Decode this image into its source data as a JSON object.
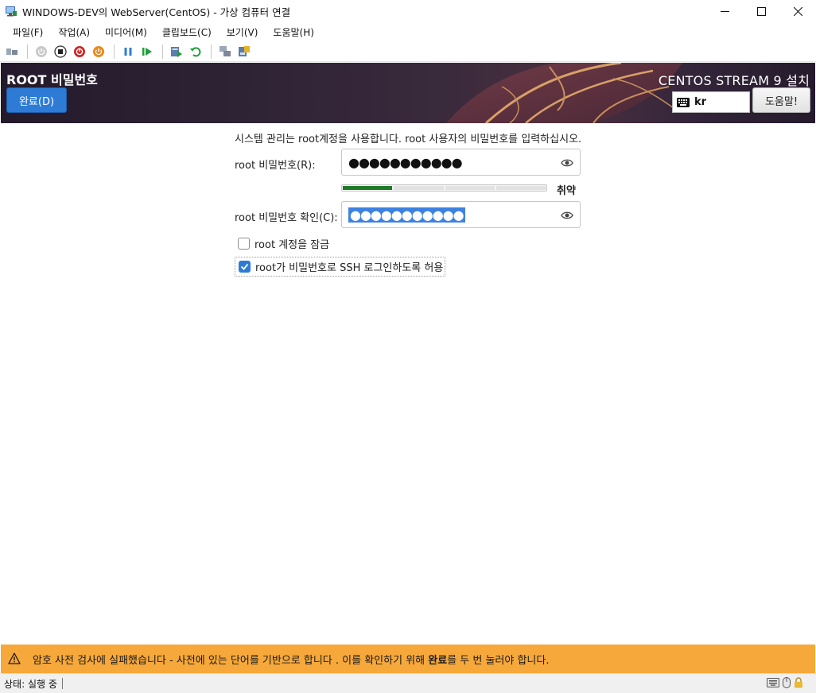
{
  "window": {
    "title": "WINDOWS-DEV의 WebServer(CentOS) - 가상 컴퓨터 연결",
    "minimize_glyph": "—",
    "maximize_glyph": "☐",
    "close_glyph": "✕"
  },
  "menubar": {
    "items": [
      {
        "label": "파일(F)"
      },
      {
        "label": "작업(A)"
      },
      {
        "label": "미디어(M)"
      },
      {
        "label": "클립보드(C)"
      },
      {
        "label": "보기(V)"
      },
      {
        "label": "도움말(H)"
      }
    ]
  },
  "toolbar": {
    "icons": [
      "ctrl-alt-del-icon",
      "start-icon",
      "turn-off-icon",
      "shutdown-icon",
      "save-icon",
      "pause-icon",
      "resume-icon",
      "checkpoint-icon",
      "revert-icon",
      "enhanced-session-icon",
      "share-icon"
    ]
  },
  "header": {
    "spoke_title": "ROOT 비밀번호",
    "done_label": "완료(D)",
    "product_title": "CENTOS STREAM 9 설치",
    "keyboard_layout": "kr",
    "help_label": "도움말!"
  },
  "form": {
    "description": "시스템 관리는 root계정을 사용합니다. root 사용자의 비밀번호를 입력하십시오.",
    "password_label": "root 비밀번호(R):",
    "password_value": "●●●●●●●●●●●",
    "strength_fraction": 0.25,
    "strength_label": "취약",
    "confirm_label": "root 비밀번호 확인(C):",
    "confirm_value": "●●●●●●●●●●●",
    "lock_label": "root 계정을 잠금",
    "lock_checked": false,
    "ssh_label": "root가 비밀번호로 SSH 로그인하도록 허용",
    "ssh_checked": true
  },
  "warning": {
    "text_before": "암호 사전 검사에 실패했습니다 - 사전에 있는 단어를 기반으로 합니다  . 이를 확인하기 위해 ",
    "text_bold": "완료",
    "text_after": "를 두 번 눌러야 합니다."
  },
  "status": {
    "text": "상태: 실행 중"
  },
  "colors": {
    "accent": "#2e7bd6",
    "warning": "#f6a83a",
    "strength_weak": "#1e7a27"
  }
}
